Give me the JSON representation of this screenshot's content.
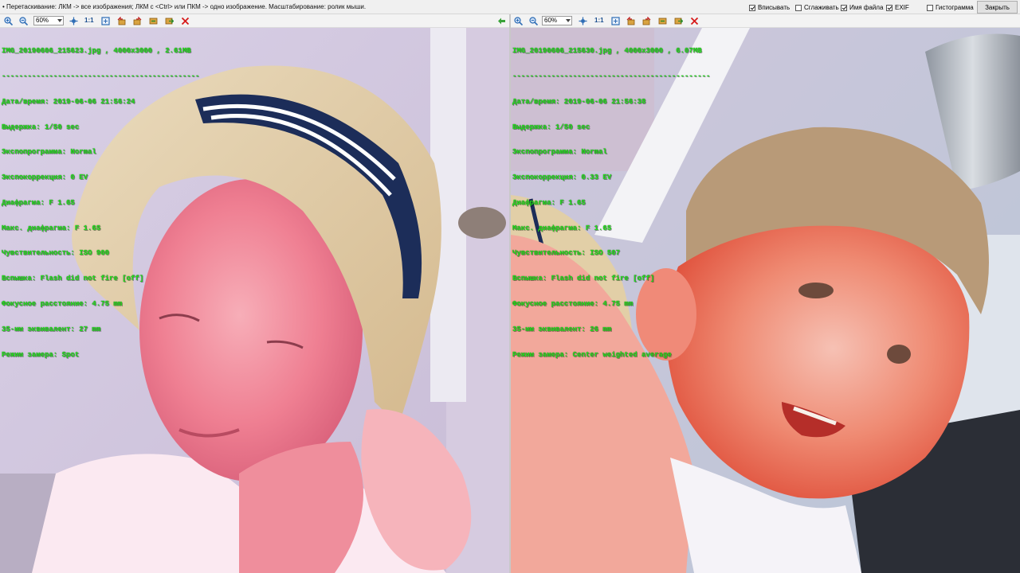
{
  "topbar": {
    "hint": "• Перетаскивание: ЛКМ -> все изображения; ЛКМ с <Ctrl> или ПКМ -> одно изображение. Масштабирование: ролик мыши.",
    "options": [
      {
        "label": "Вписывать",
        "checked": true
      },
      {
        "label": "Сглаживать",
        "checked": false
      },
      {
        "label": "Имя файла",
        "checked": true
      },
      {
        "label": "EXIF",
        "checked": true
      },
      {
        "label": "Гистограмма",
        "checked": false
      }
    ],
    "close_label": "Закрыть"
  },
  "colors": {
    "exif_text": "#22e01c",
    "toolbar_icon": "#2f6db5",
    "delete_icon": "#d61a1a",
    "arrow_icon": "#3aa33a"
  },
  "left": {
    "zoom": "60%",
    "ratio_label": "1:1",
    "exif": {
      "filename_line": "IMG_20190606_215623.jpg , 4000x3000 , 2.61MB",
      "separator": "----------------------------------------------",
      "datetime": "Дата/время: 2019-06-06 21:56:24",
      "exposure": "Выдержка: 1/50 sec",
      "program": "Экспопрограмма: Normal",
      "exposure_bias": "Экспокоррекция: 0 EV",
      "aperture": "Диафрагма: F 1.65",
      "max_aperture": "Макс. диафрагма: F 1.65",
      "iso": "Чувствительность: ISO 900",
      "flash": "Вспышка: Flash did not fire [off]",
      "focal_length": "Фокусное расстояние: 4.75 mm",
      "focal_35mm": "35-мм эквивалент: 27 mm",
      "metering": "Режим замера: Spot"
    }
  },
  "right": {
    "zoom": "60%",
    "ratio_label": "1:1",
    "exif": {
      "filename_line": "IMG_20190606_215630.jpg , 4000x3000 , 6.07MB",
      "separator": "----------------------------------------------",
      "datetime": "Дата/время: 2019-06-06 21:56:38",
      "exposure": "Выдержка: 1/50 sec",
      "program": "Экспопрограмма: Normal",
      "exposure_bias": "Экспокоррекция: 0.33 EV",
      "aperture": "Диафрагма: F 1.65",
      "max_aperture": "Макс. диафрагма: F 1.65",
      "iso": "Чувствительность: ISO 507",
      "flash": "Вспышка: Flash did not fire [off]",
      "focal_length": "Фокусное расстояние: 4.75 mm",
      "focal_35mm": "35-мм эквивалент: 26 mm",
      "metering": "Режим замера: Center weighted average"
    }
  }
}
